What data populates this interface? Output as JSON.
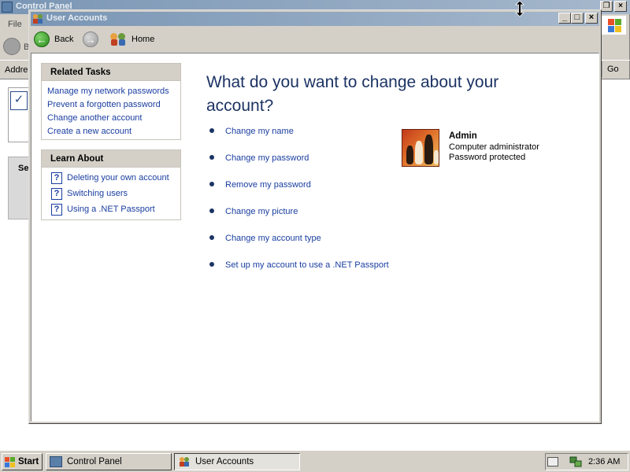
{
  "background_window": {
    "title": "Control Panel",
    "menu_file": "File",
    "back_partial": "B",
    "address_label": "Addre",
    "go_label": "Go",
    "side_label_partial": "Se"
  },
  "window": {
    "title": "User Accounts",
    "minimize": "_",
    "maximize": "□",
    "close": "×"
  },
  "toolbar": {
    "back_label": "Back",
    "home_label": "Home"
  },
  "related_tasks": {
    "header": "Related Tasks",
    "items": [
      {
        "label": "Manage my network passwords"
      },
      {
        "label": "Prevent a forgotten password"
      },
      {
        "label": "Change another account"
      },
      {
        "label": "Create a new account"
      }
    ]
  },
  "learn_about": {
    "header": "Learn About",
    "items": [
      {
        "label": "Deleting your own account",
        "icon": "help-icon"
      },
      {
        "label": "Switching users",
        "icon": "help-icon"
      },
      {
        "label": "Using a .NET Passport",
        "icon": "help-icon"
      }
    ]
  },
  "main": {
    "heading": "What do you want to change about your account?",
    "actions": [
      {
        "label": "Change my name"
      },
      {
        "label": "Change my password"
      },
      {
        "label": "Remove my password"
      },
      {
        "label": "Change my picture"
      },
      {
        "label": "Change my account type"
      },
      {
        "label": "Set up my account to use a .NET Passport"
      }
    ]
  },
  "profile": {
    "name": "Admin",
    "role": "Computer administrator",
    "status": "Password protected",
    "picture": "chess-pieces-image"
  },
  "taskbar": {
    "start_label": "Start",
    "buttons": [
      {
        "label": "Control Panel",
        "active": false
      },
      {
        "label": "User Accounts",
        "active": true
      }
    ],
    "clock": "2:36 AM"
  },
  "colors": {
    "link": "#1a3ea0",
    "heading": "#1c3364",
    "titlebar_inactive_start": "#7a96b5",
    "titlebar_inactive_end": "#a6b8cc",
    "chrome": "#d4d0c8"
  }
}
